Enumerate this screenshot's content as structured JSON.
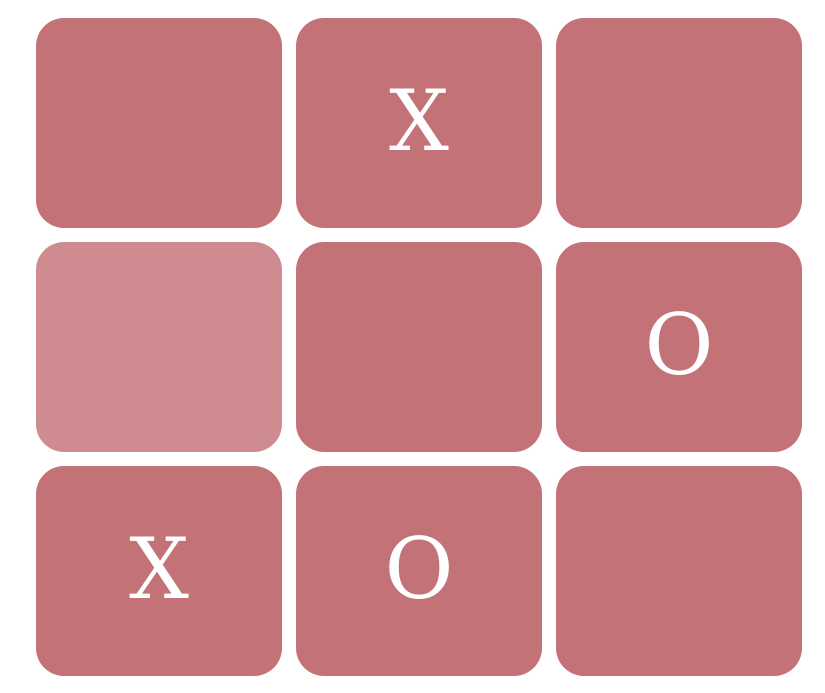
{
  "board": {
    "colors": {
      "cell": "#c37277",
      "cell_highlighted": "#cf8c90",
      "mark": "#ffffff"
    },
    "cells": [
      {
        "mark": "",
        "highlighted": false
      },
      {
        "mark": "X",
        "highlighted": false
      },
      {
        "mark": "",
        "highlighted": false
      },
      {
        "mark": "",
        "highlighted": true
      },
      {
        "mark": "",
        "highlighted": false
      },
      {
        "mark": "O",
        "highlighted": false
      },
      {
        "mark": "X",
        "highlighted": false
      },
      {
        "mark": "O",
        "highlighted": false
      },
      {
        "mark": "",
        "highlighted": false
      }
    ]
  }
}
